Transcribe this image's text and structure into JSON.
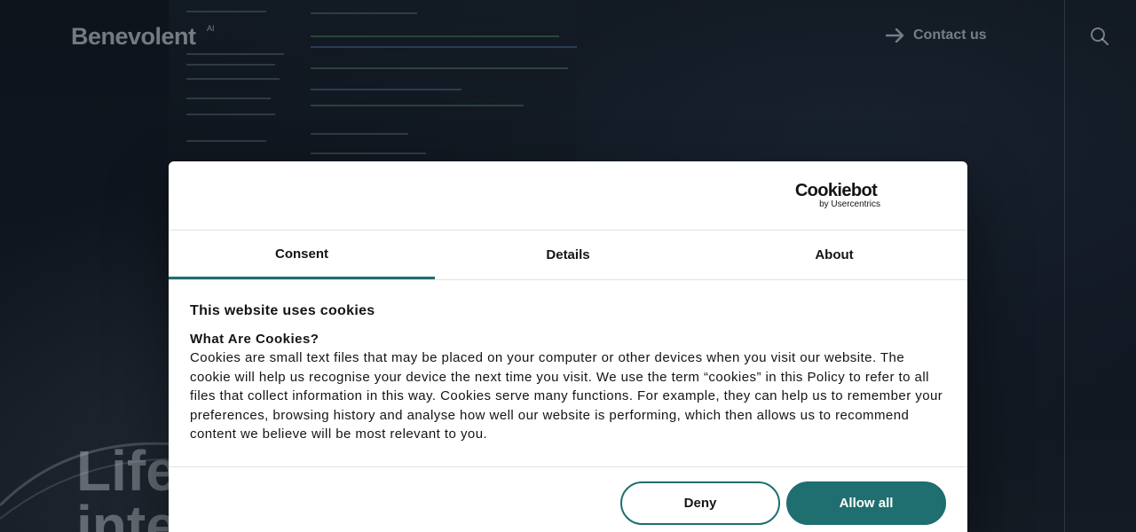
{
  "site": {
    "logo_text": "Benevolent",
    "logo_superscript": "AI",
    "contact_label": "Contact us",
    "hero_title": [
      "Life",
      "inte"
    ]
  },
  "dialog": {
    "brand": {
      "name": "Cookiebot",
      "sub": "by Usercentrics"
    },
    "tabs": [
      {
        "label": "Consent",
        "active": true
      },
      {
        "label": "Details",
        "active": false
      },
      {
        "label": "About",
        "active": false
      }
    ],
    "title": "This website uses cookies",
    "subtitle": "What Are Cookies?",
    "text": "Cookies are small text files that may be placed on your computer or other devices when you visit our website. The cookie will help us recognise your device the next time you visit. We use the term “cookies” in this Policy to refer to all files that collect information in this way. Cookies serve many functions. For example, they can help us to remember your preferences, browsing history and analyse how well our website is performing, which then allows us to recommend content we believe will be most relevant to you.",
    "buttons": {
      "deny": "Deny",
      "allow": "Allow all"
    }
  },
  "colors": {
    "accent": "#1f6e70",
    "page_background": "#0c1016"
  },
  "icons": {
    "contact": "arrow-right-icon",
    "search": "search-icon"
  }
}
